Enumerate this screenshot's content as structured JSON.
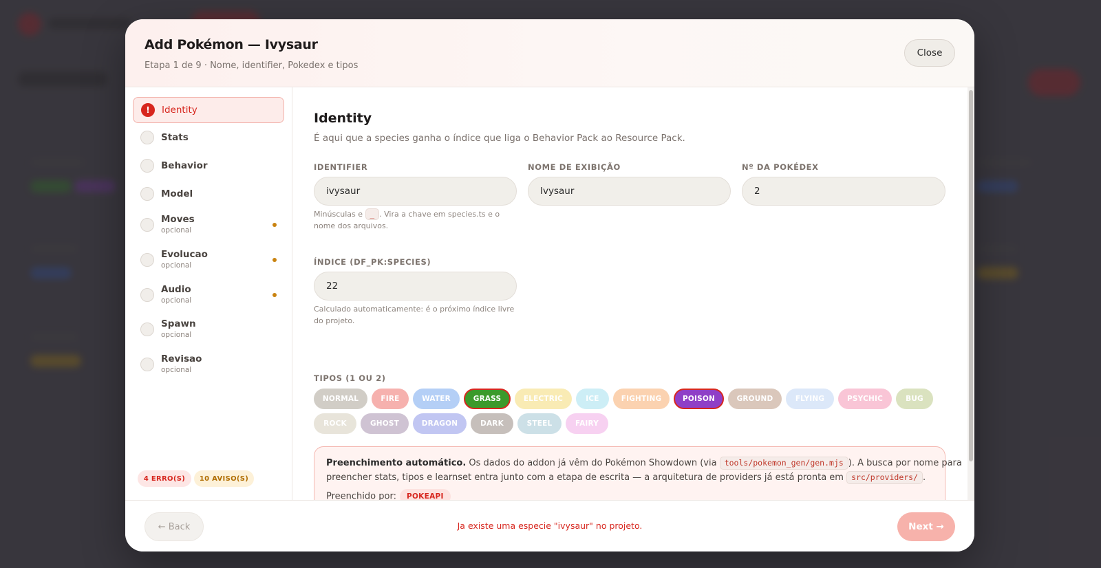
{
  "modal": {
    "title": "Add Pokémon — Ivysaur",
    "subtitle": "Etapa 1 de 9 · Nome, identifier, Pokedex e tipos",
    "close_label": "Close"
  },
  "sidebar": {
    "steps": [
      {
        "label": "Identity",
        "sub": "",
        "state": "error"
      },
      {
        "label": "Stats",
        "sub": ""
      },
      {
        "label": "Behavior",
        "sub": ""
      },
      {
        "label": "Model",
        "sub": ""
      },
      {
        "label": "Moves",
        "sub": "opcional",
        "warning": true
      },
      {
        "label": "Evolucao",
        "sub": "opcional",
        "warning": true
      },
      {
        "label": "Audio",
        "sub": "opcional",
        "warning": true
      },
      {
        "label": "Spawn",
        "sub": "opcional"
      },
      {
        "label": "Revisao",
        "sub": "opcional"
      }
    ],
    "error_icon": "!",
    "errors_badge": "4 ERRO(S)",
    "warnings_badge": "10 AVISO(S)"
  },
  "content": {
    "title": "Identity",
    "description": "É aqui que a species ganha o índice que liga o Behavior Pack ao Resource Pack.",
    "identifier": {
      "label": "IDENTIFIER",
      "value": "ivysaur",
      "hint_before": "Minúsculas e ",
      "hint_code": "_",
      "hint_after": ". Vira a chave em species.ts e o nome dos arquivos."
    },
    "display_name": {
      "label": "NOME DE EXIBIÇÃO",
      "value": "Ivysaur"
    },
    "pokedex": {
      "label": "Nº DA POKÉDEX",
      "value": "2"
    },
    "index": {
      "label": "ÍNDICE (DF_PK:SPECIES)",
      "value": "22",
      "hint": "Calculado automaticamente: é o próximo índice livre do projeto."
    },
    "types_label": "TIPOS (1 OU 2)",
    "types": [
      {
        "label": "NORMAL",
        "color": "#c9c5bd",
        "selected": false
      },
      {
        "label": "FIRE",
        "color": "#f5a4a0",
        "selected": false
      },
      {
        "label": "WATER",
        "color": "#a8c7f5",
        "selected": false
      },
      {
        "label": "GRASS",
        "color": "#3b9a2b",
        "selected": true
      },
      {
        "label": "ELECTRIC",
        "color": "#f8e8a8",
        "selected": false
      },
      {
        "label": "ICE",
        "color": "#c5ecf5",
        "selected": false
      },
      {
        "label": "FIGHTING",
        "color": "#fbcba3",
        "selected": false
      },
      {
        "label": "POISON",
        "color": "#8f3fc7",
        "selected": true
      },
      {
        "label": "GROUND",
        "color": "#d4beb0",
        "selected": false
      },
      {
        "label": "FLYING",
        "color": "#d6e4f8",
        "selected": false
      },
      {
        "label": "PSYCHIC",
        "color": "#f9bcd0",
        "selected": false
      },
      {
        "label": "BUG",
        "color": "#d4ddb4",
        "selected": false
      },
      {
        "label": "ROCK",
        "color": "#e4e0d4",
        "selected": false
      },
      {
        "label": "GHOST",
        "color": "#c7b9cc",
        "selected": false
      },
      {
        "label": "DRAGON",
        "color": "#b7bdf0",
        "selected": false
      },
      {
        "label": "DARK",
        "color": "#bdb5b0",
        "selected": false
      },
      {
        "label": "STEEL",
        "color": "#c4dbe3",
        "selected": false
      },
      {
        "label": "FAIRY",
        "color": "#f6c9ef",
        "selected": false
      }
    ],
    "autofill": {
      "title": "Preenchimento automático.",
      "text1": " Os dados do addon já vêm do Pokémon Showdown (via ",
      "code1": "tools/pokemon_gen/gen.mjs",
      "text2": "). A busca por nome para",
      "text3": "preencher stats, tipos e learnset entra junto com a etapa de escrita — a arquitetura de providers já está pronta em ",
      "code2": "src/providers/",
      "text4": ".",
      "filled_by_label": "Preenchido por:",
      "filled_by_value": "POKEAPI"
    }
  },
  "footer": {
    "back_label": "← Back",
    "message": "Ja existe uma especie \"ivysaur\" no projeto.",
    "next_label": "Next →"
  },
  "colors": {
    "accent": "#d7261e",
    "warning": "#c98310"
  }
}
